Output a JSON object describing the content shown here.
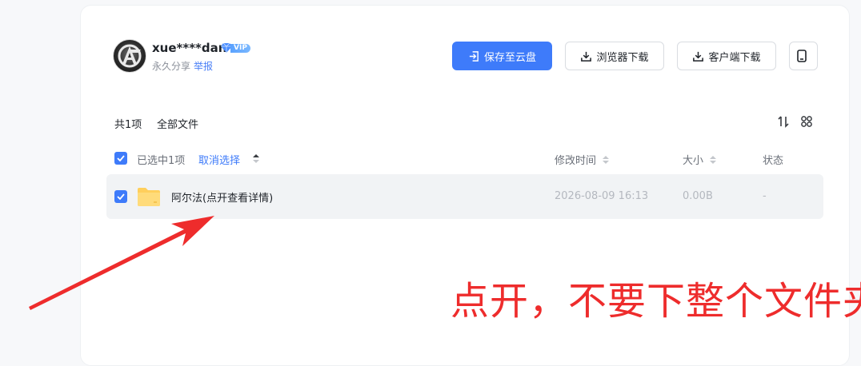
{
  "user": {
    "name": "xue****dan",
    "vip_label": "VIP",
    "share_type": "永久分享",
    "report_label": "举报"
  },
  "toolbar": {
    "save_label": "保存至云盘",
    "browser_download_label": "浏览器下载",
    "client_download_label": "客户端下载"
  },
  "list": {
    "count_label": "共1项",
    "breadcrumb": "全部文件",
    "selected_label": "已选中1项",
    "cancel_select_label": "取消选择",
    "columns": {
      "mtime": "修改时间",
      "size": "大小",
      "status": "状态"
    },
    "rows": [
      {
        "name": "阿尔法(点开查看详情)",
        "mtime": "2026-08-09 16:13",
        "size": "0.00B",
        "status": "-"
      }
    ]
  },
  "annotation": {
    "text": "点开，不要下整个文件夹",
    "color": "#ee2c2c"
  },
  "colors": {
    "accent": "#3e7bfa",
    "folder": "#ffd66b"
  }
}
